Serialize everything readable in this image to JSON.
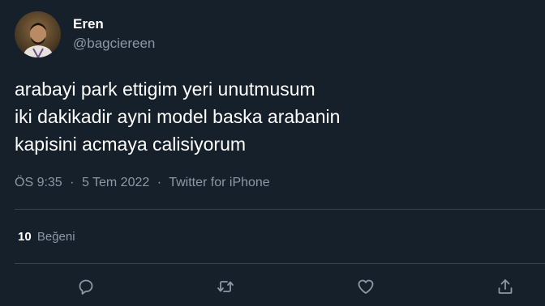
{
  "author": {
    "display_name": "Eren",
    "handle": "@bagciereen"
  },
  "tweet": {
    "lines": [
      "arabayi park ettigim yeri unutmusum",
      "iki dakikadir ayni model baska arabanin",
      "kapisini acmaya calisiyorum"
    ],
    "time": "ÖS 9:35",
    "date": "5 Tem 2022",
    "source": "Twitter for iPhone",
    "separator": "·"
  },
  "stats": {
    "likes_count": "10",
    "likes_label": "Beğeni"
  },
  "actions": [
    {
      "icon": "reply-icon"
    },
    {
      "icon": "retweet-icon"
    },
    {
      "icon": "like-icon"
    },
    {
      "icon": "share-icon"
    }
  ],
  "colors": {
    "background": "#15202b",
    "text_primary": "#ffffff",
    "text_secondary": "#8b98a5",
    "divider": "#38444d"
  }
}
